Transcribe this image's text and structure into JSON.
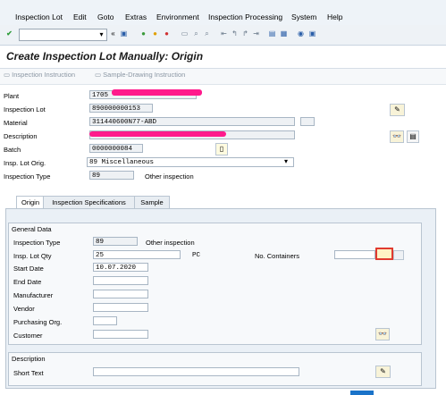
{
  "menu": {
    "items": [
      {
        "label": "Inspection Lot"
      },
      {
        "label": "Edit"
      },
      {
        "label": "Goto"
      },
      {
        "label": "Extras"
      },
      {
        "label": "Environment"
      },
      {
        "label": "Inspection Processing"
      },
      {
        "label": "System"
      },
      {
        "label": "Help"
      }
    ]
  },
  "screen": {
    "title": "Create Inspection Lot Manually: Origin"
  },
  "app_toolbar": {
    "inspection_instruction": "Inspection Instruction",
    "sample_drawing_instruction": "Sample-Drawing Instruction"
  },
  "header": {
    "plant_label": "Plant",
    "plant_value": "1705",
    "lot_label": "Inspection Lot",
    "lot_value": "890000000153",
    "material_label": "Material",
    "material_value": "311440600N77-ABD",
    "description_label": "Description",
    "batch_label": "Batch",
    "batch_value": "0000000084",
    "lot_origin_label": "Insp. Lot Orig.",
    "lot_origin_value": "89 Miscellaneous",
    "insp_type_label": "Inspection Type",
    "insp_type_value": "89",
    "insp_type_text": "Other inspection"
  },
  "tabs": [
    {
      "label": "Origin"
    },
    {
      "label": "Inspection Specifications"
    },
    {
      "label": "Sample"
    }
  ],
  "general": {
    "title": "General Data",
    "insp_type_label": "Inspection Type",
    "insp_type_value": "89",
    "insp_type_text": "Other inspection",
    "qty_label": "Insp. Lot Qty",
    "qty_value": "25",
    "qty_unit": "PC",
    "containers_label": "No. Containers",
    "start_label": "Start Date",
    "start_value": "10.07.2020",
    "end_label": "End Date",
    "manufacturer_label": "Manufacturer",
    "vendor_label": "Vendor",
    "purch_org_label": "Purchasing Org.",
    "customer_label": "Customer"
  },
  "description_group": {
    "title": "Description",
    "short_text_label": "Short Text"
  },
  "colors": {
    "redaction": "#ff1a8c",
    "accent_border": "#e03a2f"
  }
}
